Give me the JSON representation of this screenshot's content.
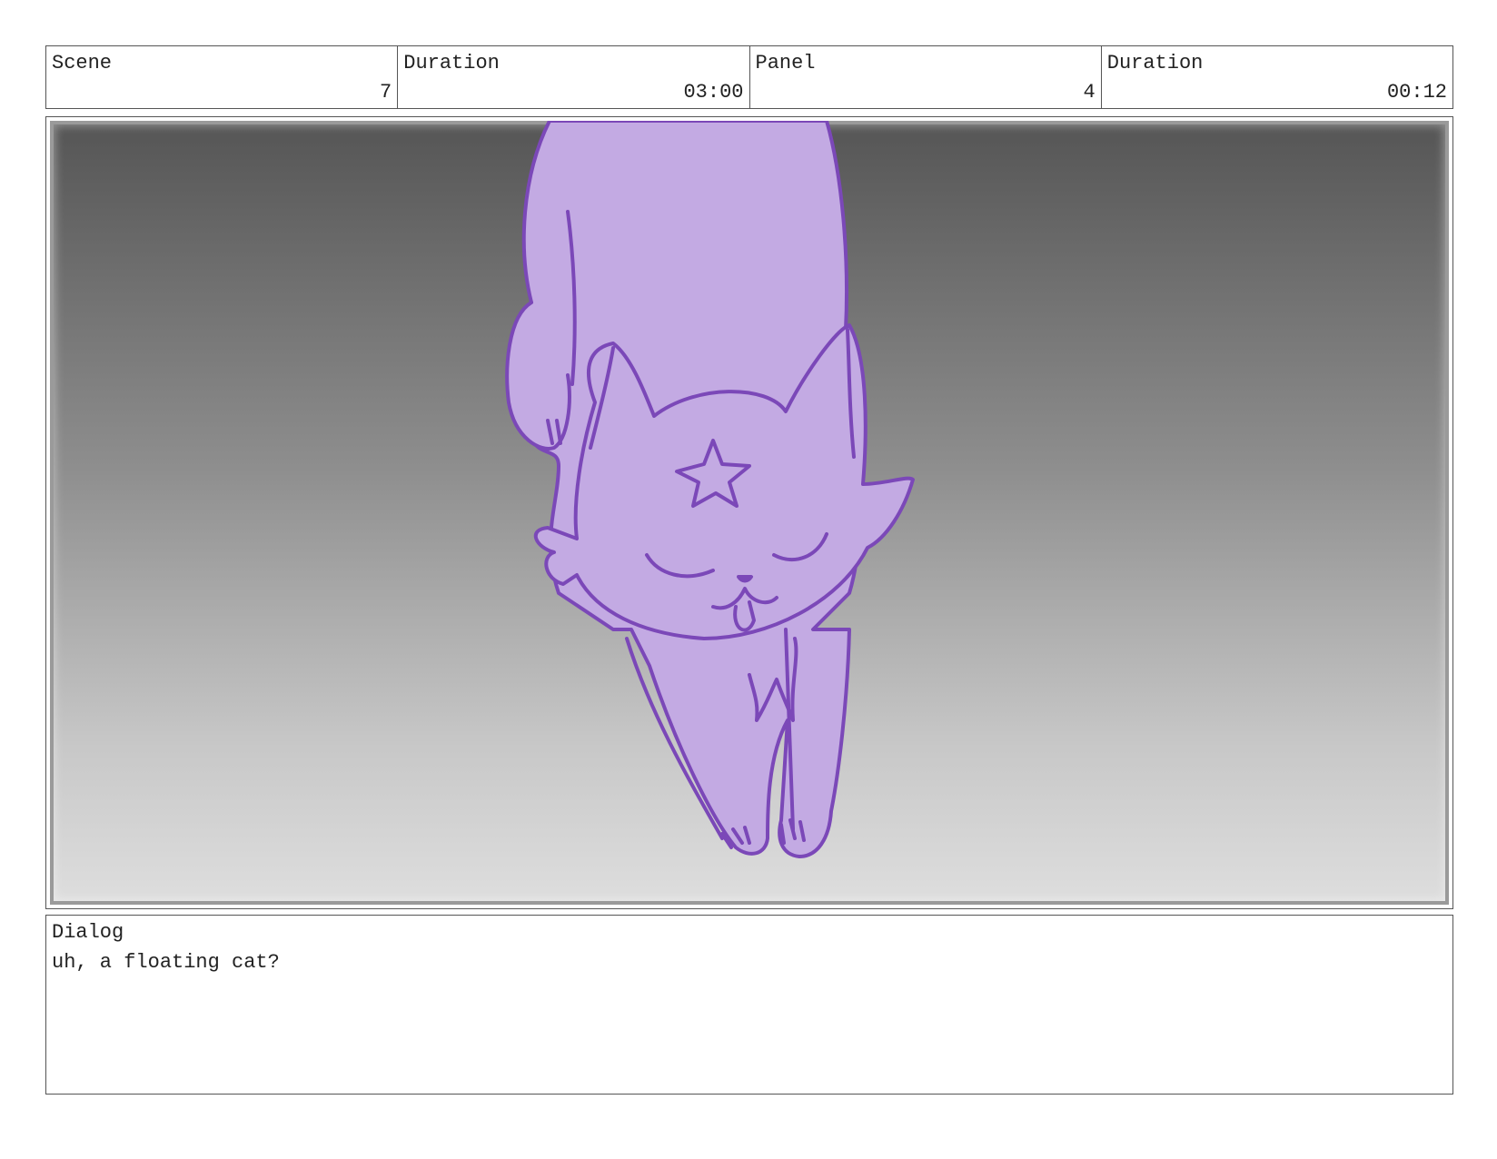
{
  "header": {
    "scene_label": "Scene",
    "scene_value": "7",
    "scene_duration_label": "Duration",
    "scene_duration_value": "03:00",
    "panel_label": "Panel",
    "panel_value": "4",
    "panel_duration_label": "Duration",
    "panel_duration_value": "00:12"
  },
  "panel": {
    "subject": "cat-drawing",
    "colors": {
      "cat_fill": "#c3aae3",
      "cat_line": "#7b48b8",
      "background_top": "#555555",
      "background_bottom": "#dedede"
    }
  },
  "dialog": {
    "label": "Dialog",
    "text": "uh, a floating cat?"
  }
}
